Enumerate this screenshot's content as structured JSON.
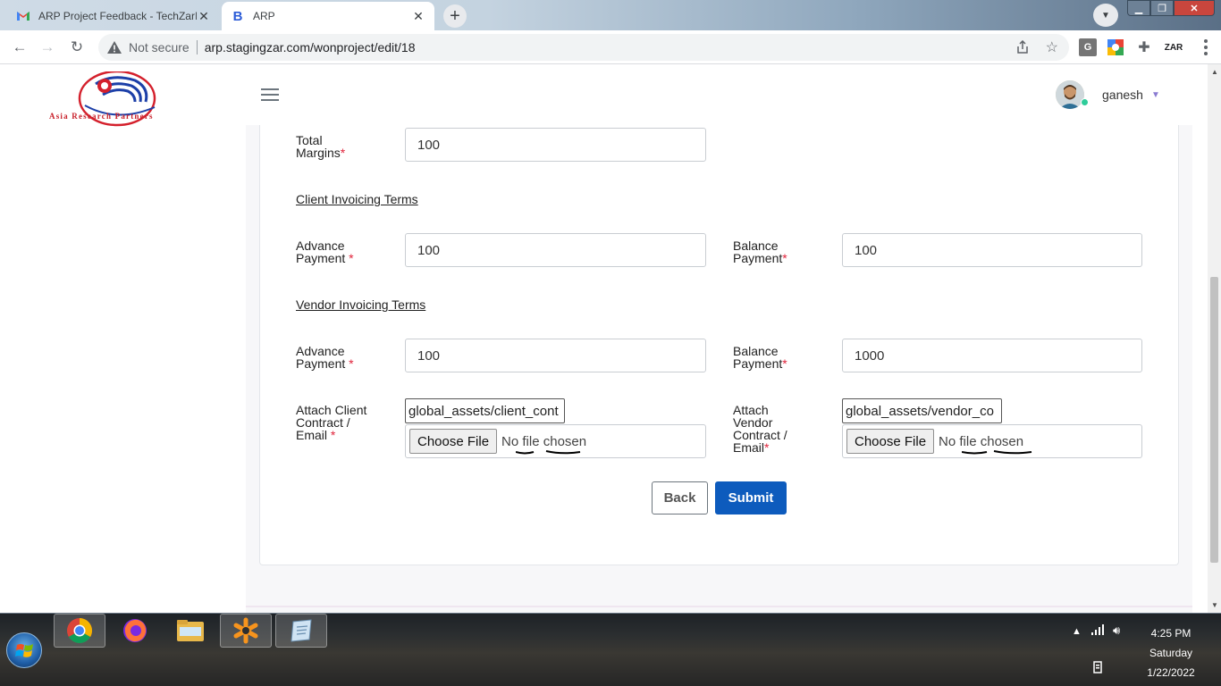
{
  "browser": {
    "tabs": [
      {
        "title": "ARP Project Feedback - TechZarI",
        "active": false,
        "favicon": "gmail-icon"
      },
      {
        "title": "ARP",
        "active": true,
        "favicon": "bootstrap-b-icon"
      }
    ],
    "new_tab": "+",
    "security_label": "Not secure",
    "url": "arp.stagingzar.com/wonproject/edit/18"
  },
  "app": {
    "logo_text": "Asia Research Partners",
    "user_name": "ganesh"
  },
  "form": {
    "total_margins": {
      "label_line1": "Total",
      "label_line2": "Margins",
      "value": "100"
    },
    "client_section": "Client Invoicing Terms",
    "client_advance": {
      "label_line1": "Advance",
      "label_line2": "Payment ",
      "value": "100"
    },
    "client_balance": {
      "label_line1": "Balance",
      "label_line2": "Payment",
      "value": "100"
    },
    "vendor_section": "Vendor Invoicing Terms",
    "vendor_advance": {
      "label_line1": "Advance",
      "label_line2": "Payment ",
      "value": "100"
    },
    "vendor_balance": {
      "label_line1": "Balance",
      "label_line2": "Payment",
      "value": "1000"
    },
    "client_contract": {
      "label_line1": "Attach Client",
      "label_line2": "Contract /",
      "label_line3": "Email ",
      "path": "global_assets/client_cont",
      "choose": "Choose File",
      "nofile": "No file chosen"
    },
    "vendor_contract": {
      "label_line1": "Attach",
      "label_line2": "Vendor",
      "label_line3": "Contract /",
      "label_line4": "Email",
      "path": "global_assets/vendor_co",
      "choose": "Choose File",
      "nofile": "No file chosen"
    },
    "required_mark": "*",
    "back_label": "Back",
    "submit_label": "Submit"
  },
  "taskbar": {
    "time": "4:25 PM",
    "day": "Saturday",
    "date": "1/22/2022"
  },
  "colors": {
    "primary": "#0d5bbd",
    "required": "#e0243b",
    "logo_blue": "#1c3fa8",
    "logo_red": "#d4202c"
  }
}
